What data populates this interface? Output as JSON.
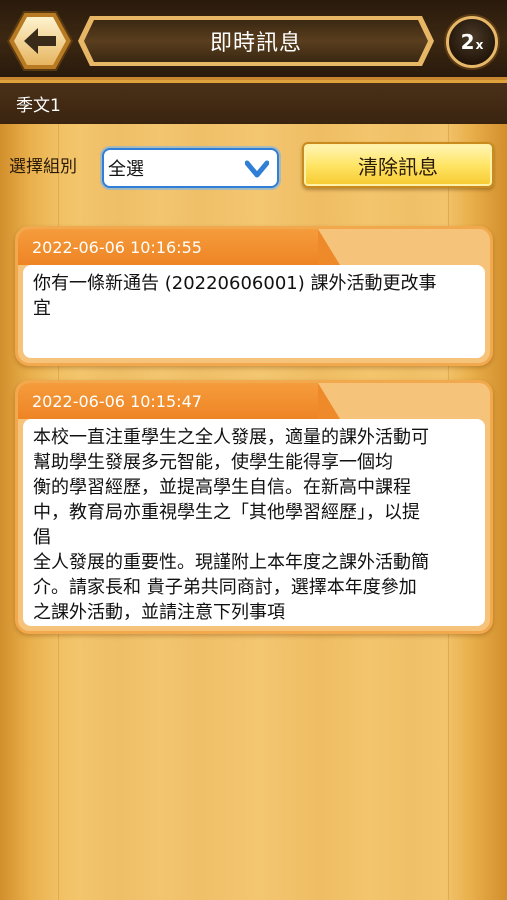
{
  "header": {
    "title": "即時訊息",
    "speed_value": "2",
    "speed_suffix": "x"
  },
  "user": {
    "name": "季文1"
  },
  "filter": {
    "label": "選擇組別",
    "selected": "全選",
    "clear_label": "清除訊息"
  },
  "messages": [
    {
      "timestamp": "2022-06-06 10:16:55",
      "lines": [
        "你有一條新通告 (20220606001) 課外活動更改事",
        "宜"
      ]
    },
    {
      "timestamp": "2022-06-06 10:15:47",
      "lines": [
        "本校一直注重學生之全人發展，適量的課外活動可",
        "幫助學生發展多元智能，使學生能得享一個均",
        "衡的學習經歷，並提高學生自信。在新高中課程",
        "中，教育局亦重視學生之「其他學習經歷」，以提",
        "倡",
        "全人發展的重要性。現謹附上本年度之課外活動簡",
        "介。請家長和 貴子弟共同商討，選擇本年度參加",
        "之課外活動，並請注意下列事項"
      ]
    }
  ],
  "colors": {
    "accent_orange": "#ee8424",
    "select_border": "#2f7fd6",
    "button_yellow": "#ffe566"
  },
  "icons": {
    "back": "back-arrow-icon",
    "dropdown": "chevron-down-icon"
  }
}
